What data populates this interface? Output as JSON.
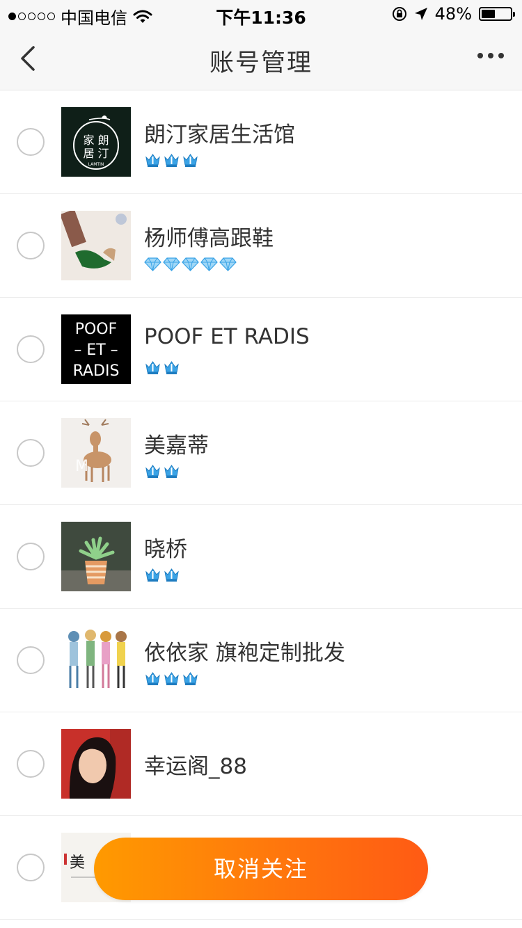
{
  "status_bar": {
    "carrier": "中国电信",
    "time": "下午11:36",
    "battery_percent_text": "48%",
    "battery_level": 0.48,
    "signal_bars_filled": 1,
    "signal_bars_total": 5
  },
  "nav": {
    "title": "账号管理",
    "back_icon": "chevron-left-icon",
    "more_icon": "more-dots-icon"
  },
  "accounts": [
    {
      "name": "朗汀家居生活馆",
      "badge_type": "crown",
      "badge_count": 3,
      "avatar": {
        "lines": [
          "家 朗",
          "居 汀"
        ],
        "sub": "LAMTIN"
      }
    },
    {
      "name": "杨师傅高跟鞋",
      "badge_type": "diamond",
      "badge_count": 5
    },
    {
      "name": "POOF ET RADIS",
      "badge_type": "crown",
      "badge_count": 2,
      "avatar": {
        "lines": [
          "POOF",
          "– ET –",
          "RADIS"
        ]
      }
    },
    {
      "name": "美嘉蒂",
      "badge_type": "crown",
      "badge_count": 2
    },
    {
      "name": "晓桥",
      "badge_type": "crown",
      "badge_count": 2
    },
    {
      "name": "依依家 旗袍定制批发",
      "badge_type": "crown",
      "badge_count": 3
    },
    {
      "name": "幸运阁_88",
      "badge_type": "none",
      "badge_count": 0
    },
    {
      "name": "",
      "badge_type": "none",
      "badge_count": 0,
      "avatar": {
        "lines": [
          "美"
        ]
      }
    }
  ],
  "unfollow_button": {
    "label": "取消关注"
  },
  "colors": {
    "accent_start": "#ff9a00",
    "accent_end": "#ff5a14",
    "badge_blue": "#3aa3e6",
    "radio_border": "#c8c8c8"
  }
}
